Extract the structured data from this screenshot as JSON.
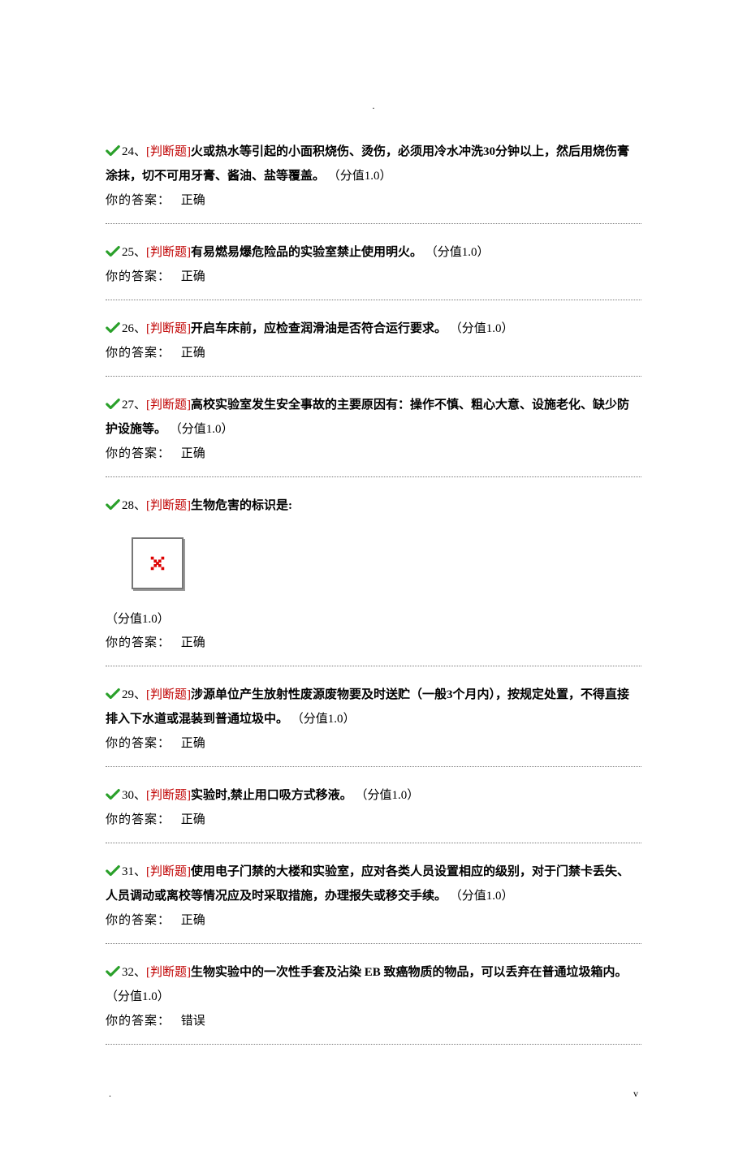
{
  "top_dot": ".",
  "labels": {
    "answer": "你的答案：",
    "qtype": "[判断题]"
  },
  "questions": [
    {
      "num": "24、",
      "text_bold": "火或热水等引起的小面积烧伤、烫伤，必须用冷水冲洗30分钟以上，然后用烧伤膏涂抹，切不可用牙膏、酱油、盐等覆盖。",
      "score": "（分值1.0）",
      "answer": "正确"
    },
    {
      "num": "25、",
      "text_bold": "有易燃易爆危险品的实验室禁止使用明火。",
      "score": "（分值1.0）",
      "answer": "正确"
    },
    {
      "num": "26、",
      "text_bold": "开启车床前，应检查润滑油是否符合运行要求。",
      "score": "（分值1.0）",
      "answer": "正确"
    },
    {
      "num": "27、",
      "text_bold": "高校实验室发生安全事故的主要原因有：操作不慎、粗心大意、设施老化、缺少防护设施等。",
      "score": "（分值1.0）",
      "answer": "正确"
    },
    {
      "num": "28、",
      "text_bold": "生物危害的标识是:",
      "score": "（分值1.0）",
      "answer": "正确",
      "has_image": true
    },
    {
      "num": "29、",
      "text_bold": "涉源单位产生放射性废源废物要及时送贮（一般3个月内），按规定处置，不得直接排入下水道或混装到普通垃圾中。",
      "score": "（分值1.0）",
      "answer": "正确"
    },
    {
      "num": "30、",
      "text_bold": "实验时,禁止用口吸方式移液。",
      "score": "（分值1.0）",
      "answer": "正确"
    },
    {
      "num": "31、",
      "text_bold": "使用电子门禁的大楼和实验室，应对各类人员设置相应的级别，对于门禁卡丢失、人员调动或离校等情况应及时采取措施，办理报失或移交手续。",
      "score": "（分值1.0）",
      "answer": "正确"
    },
    {
      "num": "32、",
      "text_bold": "生物实验中的一次性手套及沾染 EB 致癌物质的物品，可以丢弃在普通垃圾箱内。",
      "score": "（分值1.0）",
      "answer": "错误"
    }
  ],
  "footer": {
    "left": ".",
    "right": "v"
  }
}
